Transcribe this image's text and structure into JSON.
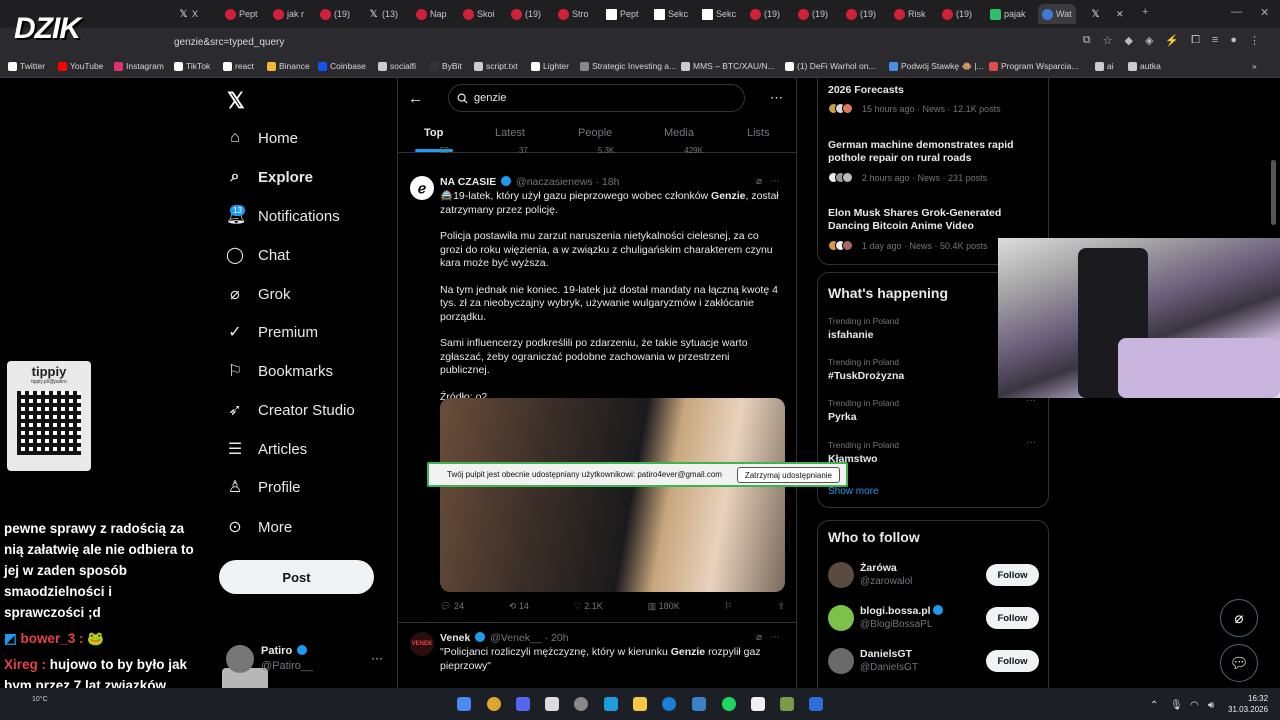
{
  "browser": {
    "tabs": [
      {
        "label": "X",
        "icon": "x"
      },
      {
        "label": "Pept",
        "icon": "yt"
      },
      {
        "label": "jak r",
        "icon": "yt"
      },
      {
        "label": "(19)",
        "icon": "yt"
      },
      {
        "label": "(13)",
        "icon": "x"
      },
      {
        "label": "Nap",
        "icon": "threads"
      },
      {
        "label": "Skoi",
        "icon": "yt"
      },
      {
        "label": "(19)",
        "icon": "yt"
      },
      {
        "label": "Stro",
        "icon": "other"
      },
      {
        "label": "Pept",
        "icon": "doc"
      },
      {
        "label": "Sekc",
        "icon": "doc"
      },
      {
        "label": "Sekc",
        "icon": "doc"
      },
      {
        "label": "(19)",
        "icon": "yt"
      },
      {
        "label": "(19)",
        "icon": "yt"
      },
      {
        "label": "(19)",
        "icon": "yt"
      },
      {
        "label": "Risk",
        "icon": "other"
      },
      {
        "label": "(19)",
        "icon": "yt"
      },
      {
        "label": "pajak",
        "icon": "green"
      },
      {
        "label": "Wat",
        "icon": "blue"
      },
      {
        "label": "",
        "icon": "x"
      }
    ],
    "url": "genzie&src=typed_query",
    "bookmarks": [
      {
        "label": "Twitter",
        "color": "#ffffff"
      },
      {
        "label": "YouTube",
        "color": "#ff0000"
      },
      {
        "label": "Instagram",
        "color": "#e1306c"
      },
      {
        "label": "TikTok",
        "color": "#ffffff"
      },
      {
        "label": "react",
        "color": "#ffffff"
      },
      {
        "label": "Binance",
        "color": "#f3ba2f"
      },
      {
        "label": "Coinbase",
        "color": "#1652f0"
      },
      {
        "label": "socialfi",
        "color": "#cccccc"
      },
      {
        "label": "ByBit",
        "color": "#333333"
      },
      {
        "label": "script.txt",
        "color": "#cccccc"
      },
      {
        "label": "Lighter",
        "color": "#ffffff"
      },
      {
        "label": "Strategic Investing a...",
        "color": "#888888"
      },
      {
        "label": "MMS – BTC/XAU/N...",
        "color": "#cccccc"
      },
      {
        "label": "(1) DeFi Warhol on...",
        "color": "#ffffff"
      },
      {
        "label": "Podwój Stawkę 🐵 |...",
        "color": "#4a90e2"
      },
      {
        "label": "Program Wsparcia...",
        "color": "#e04a4a"
      },
      {
        "label": "ai",
        "color": "#cccccc"
      },
      {
        "label": "autka",
        "color": "#cccccc"
      }
    ],
    "logo": "DZIK"
  },
  "overlay": {
    "qr_title": "tippiy",
    "qr_sub": "tippiy.pl/@patiro",
    "chat": [
      {
        "text": "pewne sprawy z radością za nią załatwię ale nie odbiera to jej w zaden sposób smaodzielności i sprawczości ;d"
      },
      {
        "user": "bower_3 :",
        "text": ""
      },
      {
        "user": "Xireg :",
        "text": " hujowo to by było jak bym przez 7 lat związków dziecko kurwa zrobił"
      }
    ],
    "cam_count": "X5",
    "weather": "10°C"
  },
  "nav": {
    "items": [
      {
        "label": "Home",
        "icon": "home-icon"
      },
      {
        "label": "Explore",
        "icon": "search-icon"
      },
      {
        "label": "Notifications",
        "icon": "bell-icon"
      },
      {
        "label": "Chat",
        "icon": "chat-icon"
      },
      {
        "label": "Grok",
        "icon": "grok-icon"
      },
      {
        "label": "Premium",
        "icon": "premium-icon"
      },
      {
        "label": "Bookmarks",
        "icon": "bookmark-icon"
      },
      {
        "label": "Creator Studio",
        "icon": "rocket-icon"
      },
      {
        "label": "Articles",
        "icon": "article-icon"
      },
      {
        "label": "Profile",
        "icon": "profile-icon"
      },
      {
        "label": "More",
        "icon": "more-icon"
      }
    ],
    "notif_count": "13",
    "post_label": "Post",
    "account": {
      "name": "Patiro",
      "handle": "@Patiro__"
    }
  },
  "search": {
    "query": "genzie",
    "tabs": [
      "Top",
      "Latest",
      "People",
      "Media",
      "Lists"
    ],
    "prev_actions": [
      "59",
      "37",
      "5.3K",
      "429K"
    ]
  },
  "tweet1": {
    "name": "NA CZASIE",
    "handle": "@naczasienews",
    "time": "· 18h",
    "line1_pre": "🚔19-latek, który użył gazu pieprzowego wobec członków ",
    "line1_bold": "Genzie",
    "line1_post": ", został zatrzymany przez policję.",
    "p2": "Policja postawiła mu zarzut naruszenia nietykalności cielesnej, za co grozi do roku więzienia, a w związku z chuligańskim charakterem czynu kara może być wyższa.",
    "p3": "Na tym jednak nie koniec. 19-latek już dostał mandaty na łączną kwotę 4 tys. zł za nieobyczajny wybryk, używanie wulgaryzmów i zakłócanie porządku.",
    "p4": "Sami influencerzy podkreślili po zdarzeniu, że takie sytuacje warto zgłaszać, żeby ograniczać podobne zachowania w przestrzeni publicznej.",
    "p5": "Źródło: o2",
    "replies": "24",
    "reposts": "14",
    "likes": "2.1K",
    "views": "180K"
  },
  "tweet2": {
    "name": "Venek",
    "handle": "@Venek__",
    "time": "· 20h",
    "avatar_text": "VENEK",
    "text_pre": "\"Policjanci rozliczyli mężczyznę, który w kierunku ",
    "text_bold": "Genzie",
    "text_post": " rozpylił gaz pieprzowy\""
  },
  "share_banner": {
    "text": "Twój pulpit jest obecnie udostępniany użytkownikowi: patiro4ever@gmail.com",
    "button": "Zatrzymaj udostępnianie"
  },
  "news": [
    {
      "title": "2026 Forecasts",
      "meta": "15 hours ago · News · 12.1K posts"
    },
    {
      "title": "German machine demonstrates rapid pothole repair on rural roads",
      "meta": "2 hours ago · News · 231 posts"
    },
    {
      "title": "Elon Musk Shares Grok-Generated Dancing Bitcoin Anime Video",
      "meta": "1 day ago · News · 50.4K posts"
    }
  ],
  "happening": {
    "title": "What's happening",
    "trends": [
      {
        "sub": "Trending in Poland",
        "name": "isfahanie"
      },
      {
        "sub": "Trending in Poland",
        "name": "#TuskDrożyzna"
      },
      {
        "sub": "Trending in Poland",
        "name": "Pyrka"
      },
      {
        "sub": "Trending in Poland",
        "name": "Kłamstwo"
      }
    ],
    "show_more": "Show more"
  },
  "who_to_follow": {
    "title": "Who to follow",
    "users": [
      {
        "name": "Żarówa",
        "handle": "@zarowalol",
        "button": "Follow",
        "color": "#5a4a40"
      },
      {
        "name": "blogi.bossa.pl",
        "handle": "@BlogiBossaPL",
        "button": "Follow",
        "color": "#7cc24a"
      },
      {
        "name": "DanielsGT",
        "handle": "@DanieIsGT",
        "button": "Follow",
        "color": "#6a6a6a"
      }
    ]
  },
  "clock": {
    "time": "16:32",
    "date": "31.03.2026"
  }
}
